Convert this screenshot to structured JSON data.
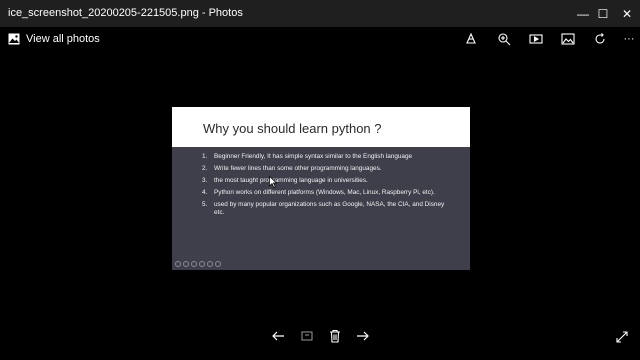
{
  "window": {
    "title": "ice_screenshot_20200205-221505.png - Photos",
    "minimize_glyph": "—",
    "maximize_glyph": "☐",
    "close_glyph": "✕"
  },
  "header": {
    "view_all_label": "View all photos"
  },
  "toolbar": {
    "icons": [
      "draw-icon",
      "zoom-in-icon",
      "slideshow-icon",
      "edit-image-icon",
      "rotate-icon",
      "more-icon"
    ],
    "more_glyph": "···"
  },
  "slide": {
    "title": "Why you should learn python ?",
    "items": [
      {
        "num": "1.",
        "text": "Beginner Friendly, It has simple syntax similar to the English language"
      },
      {
        "num": "2.",
        "text": "Write fewer lines than some other programming languages."
      },
      {
        "num": "3.",
        "text": "the most taught  programming language in universities."
      },
      {
        "num": "4.",
        "text": "Python works on different platforms (Windows, Mac, Linux, Raspberry Pi, etc)."
      },
      {
        "num": "5.",
        "text": "used by many popular organizations such as Google, NASA, the CIA, and Disney etc."
      }
    ],
    "header_color": "#ffffff",
    "body_color": "#3f3f4c"
  },
  "footer": {
    "icons": [
      "previous-icon",
      "info-icon",
      "delete-icon",
      "next-icon",
      "fullscreen-icon"
    ]
  }
}
